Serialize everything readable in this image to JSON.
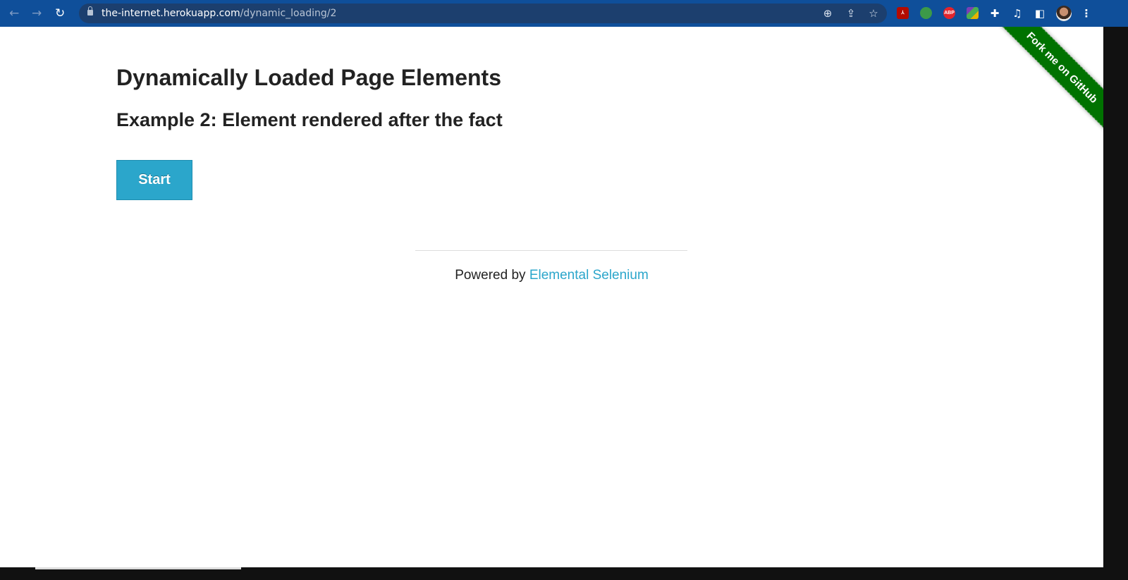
{
  "browser": {
    "url_host": "the-internet.herokuapp.com",
    "url_path": "/dynamic_loading/2",
    "extensions": [
      {
        "name": "acrobat",
        "label": "",
        "color": "#b30b00"
      },
      {
        "name": "robot",
        "label": "",
        "color": "#3c9a48"
      },
      {
        "name": "adblock-plus",
        "label": "ABP",
        "color": "#e2252d"
      },
      {
        "name": "colorful",
        "label": "",
        "color": "#e6b400"
      }
    ]
  },
  "page": {
    "title": "Dynamically Loaded Page Elements",
    "subtitle": "Example 2: Element rendered after the fact",
    "start_label": "Start",
    "footer_prefix": "Powered by ",
    "footer_link": "Elemental Selenium",
    "ribbon": "Fork me on GitHub"
  },
  "colors": {
    "accent": "#2ba6cb",
    "ribbon": "#007200",
    "toolbar": "#0f4f9a"
  }
}
